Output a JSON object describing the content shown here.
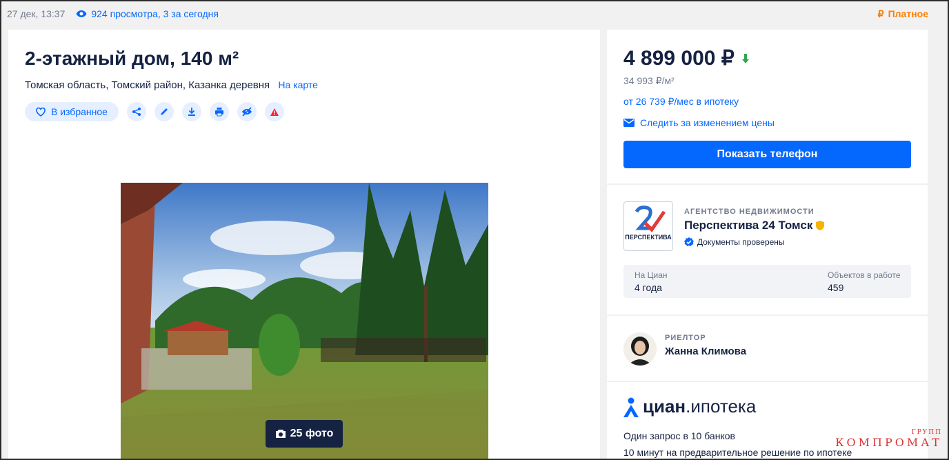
{
  "topbar": {
    "date": "27 дек, 13:37",
    "views": "924 просмотра, 3 за сегодня",
    "paid_label": "Платное",
    "paid_symbol": "₽"
  },
  "listing": {
    "title": "2-этажный дом, 140 м²",
    "address": "Томская область, Томский район, Казанка деревня",
    "map_link": "На карте",
    "favorite_label": "В избранное",
    "photo_count": "25 фото"
  },
  "price": {
    "value": "4 899 000 ₽",
    "per_m2": "34 993 ₽/м²",
    "mortgage": "от 26 739 ₽/мес в ипотеку",
    "watch_label": "Следить за изменением цены",
    "show_phone": "Показать телефон"
  },
  "agency": {
    "kind": "АГЕНТСТВО НЕДВИЖИМОСТИ",
    "name": "Перспектива 24 Томск",
    "docs": "Документы проверены",
    "logo_text": "ПЕРСПЕКТИВА",
    "stats": [
      {
        "label": "На Циан",
        "value": "4 года"
      },
      {
        "label": "Объектов в работе",
        "value": "459"
      }
    ]
  },
  "realtor": {
    "kind": "РИЕЛТОР",
    "name": "Жанна Климова"
  },
  "ipoteka": {
    "logo_bold": "циан",
    "logo_rest": ".ипотека",
    "line1": "Один запрос в 10 банков",
    "line2": "10 минут на предварительное решение по ипотеке"
  },
  "watermark": {
    "top": "ГРУПП",
    "main": "КОМПРОМАТ"
  },
  "colors": {
    "accent": "#0468ff",
    "paid": "#ff7d00",
    "text": "#152242",
    "price_down": "#2fa84f"
  }
}
